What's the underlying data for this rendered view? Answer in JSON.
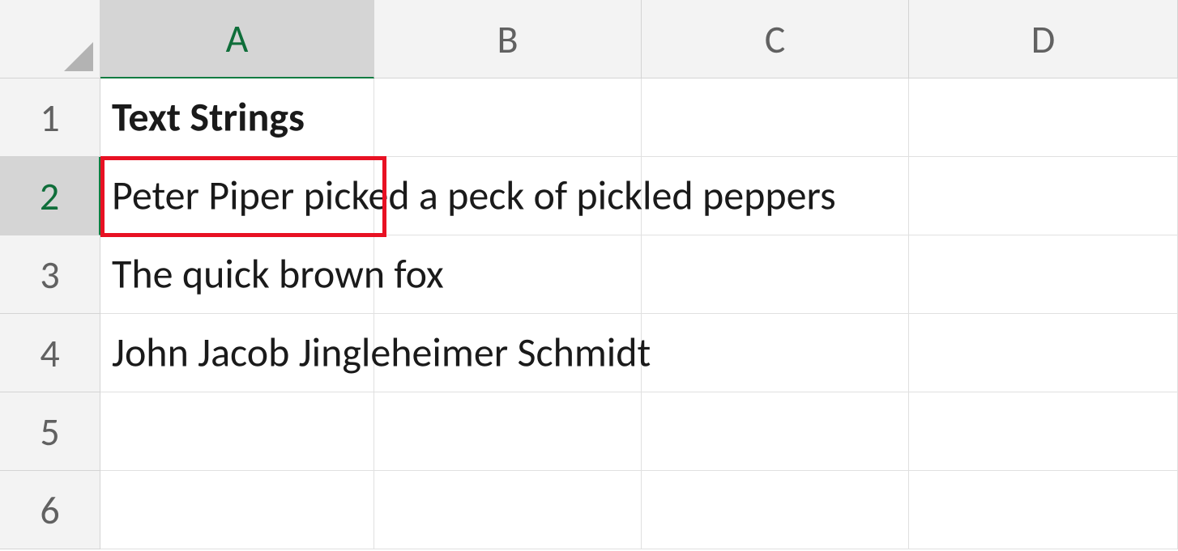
{
  "columns": [
    "A",
    "B",
    "C",
    "D"
  ],
  "rows": [
    "1",
    "2",
    "3",
    "4",
    "5",
    "6"
  ],
  "cells": {
    "a1": "Text Strings",
    "a2": "Peter Piper picked a peck of pickled peppers",
    "a3": "The quick brown fox",
    "a4": "John Jacob Jingleheimer Schmidt"
  },
  "selected": {
    "col": "A",
    "row": "2"
  }
}
